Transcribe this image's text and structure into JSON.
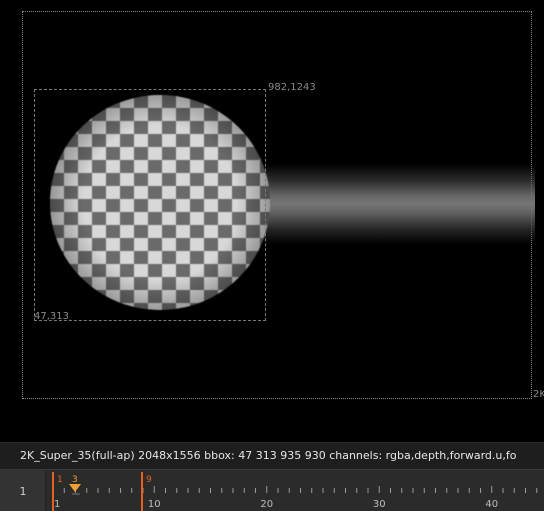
{
  "viewer": {
    "format_corner_label": "2K",
    "bbox_top_right": "982,1243",
    "bbox_bottom_left": "47,313"
  },
  "info_bar": {
    "text": "2K_Super_35(full-ap) 2048x1556  bbox: 47 313 935 930 channels: rgba,depth,forward.u,fo"
  },
  "timeline": {
    "current_frame_field": "1",
    "in_point": "1",
    "out_point": "9",
    "marker_frame": "3",
    "tick_labels": [
      "1",
      "10",
      "20",
      "30",
      "40"
    ],
    "accent_color": "#e8611e",
    "marker_color": "#f0a030"
  }
}
